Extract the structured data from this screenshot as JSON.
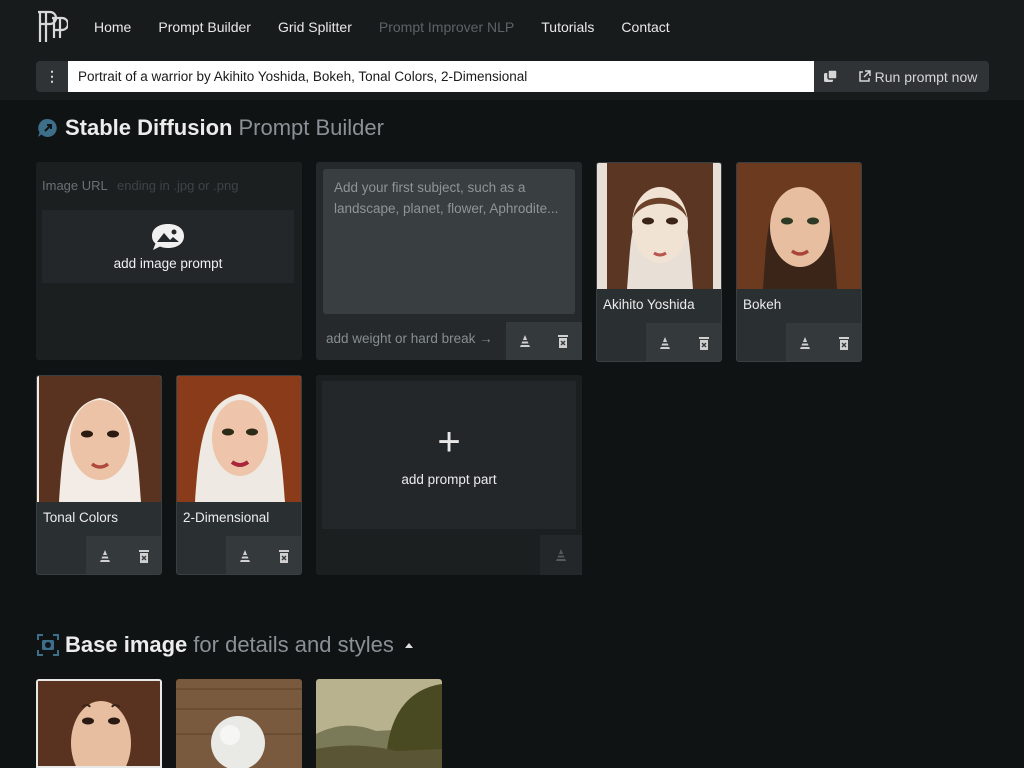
{
  "nav": {
    "items": [
      {
        "label": "Home"
      },
      {
        "label": "Prompt Builder"
      },
      {
        "label": "Grid Splitter"
      },
      {
        "label": "Prompt Improver NLP",
        "disabled": true
      },
      {
        "label": "Tutorials"
      },
      {
        "label": "Contact"
      }
    ]
  },
  "prompt_bar": {
    "menu_icon": "kebab-vertical-icon",
    "value": "Portrait of a warrior by Akihito Yoshida, Bokeh, Tonal Colors, 2-Dimensional",
    "copy_icon": "copy-icon",
    "run_label": "Run prompt now",
    "run_icon": "external-link-icon"
  },
  "builder": {
    "title_bold": "Stable Diffusion",
    "title_muted": "Prompt Builder",
    "title_icon": "speech-bubble-arrow-icon",
    "image_url": {
      "label": "Image URL",
      "placeholder": "ending in .jpg or .png",
      "add_label": "add image prompt",
      "icon": "image-bubble-icon"
    },
    "subject": {
      "placeholder": "Add your first subject, such as a landscape, planet, flower, Aphrodite...",
      "weight_label": "add weight or hard break →"
    },
    "cards": [
      {
        "name": "Akihito Yoshida"
      },
      {
        "name": "Bokeh"
      },
      {
        "name": "Tonal Colors"
      },
      {
        "name": "2-Dimensional"
      }
    ],
    "add_part_label": "add prompt part"
  },
  "base_image": {
    "title_bold": "Base image",
    "title_muted": "for details and styles",
    "title_icon": "camera-focus-icon",
    "toggle_icon": "caret-up-icon"
  },
  "colors": {
    "background": "#101314",
    "topbar": "#181b1c",
    "panel": "#1b1f20",
    "button": "#2f3335"
  }
}
